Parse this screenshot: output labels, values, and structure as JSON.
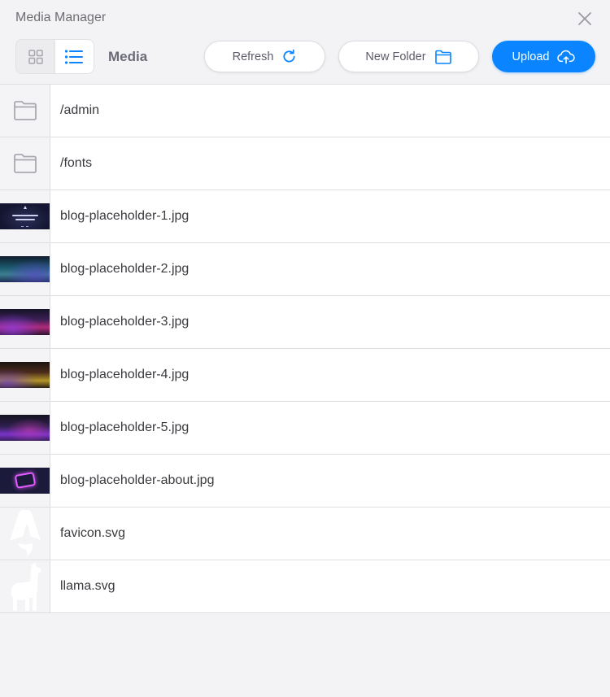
{
  "window": {
    "title": "Media Manager"
  },
  "toolbar": {
    "section_label": "Media",
    "view_modes": [
      {
        "icon": "grid-icon",
        "active": false
      },
      {
        "icon": "list-icon",
        "active": true
      }
    ],
    "refresh_label": "Refresh",
    "new_folder_label": "New Folder",
    "upload_label": "Upload"
  },
  "colors": {
    "accent": "#0a84ff",
    "icon_muted": "#a6a6ae",
    "background": "#f3f3f5"
  },
  "items": [
    {
      "name": "/admin",
      "kind": "folder"
    },
    {
      "name": "/fonts",
      "kind": "folder"
    },
    {
      "name": "blog-placeholder-1.jpg",
      "kind": "image"
    },
    {
      "name": "blog-placeholder-2.jpg",
      "kind": "image"
    },
    {
      "name": "blog-placeholder-3.jpg",
      "kind": "image"
    },
    {
      "name": "blog-placeholder-4.jpg",
      "kind": "image"
    },
    {
      "name": "blog-placeholder-5.jpg",
      "kind": "image"
    },
    {
      "name": "blog-placeholder-about.jpg",
      "kind": "image"
    },
    {
      "name": "favicon.svg",
      "kind": "svg"
    },
    {
      "name": "llama.svg",
      "kind": "svg"
    }
  ]
}
